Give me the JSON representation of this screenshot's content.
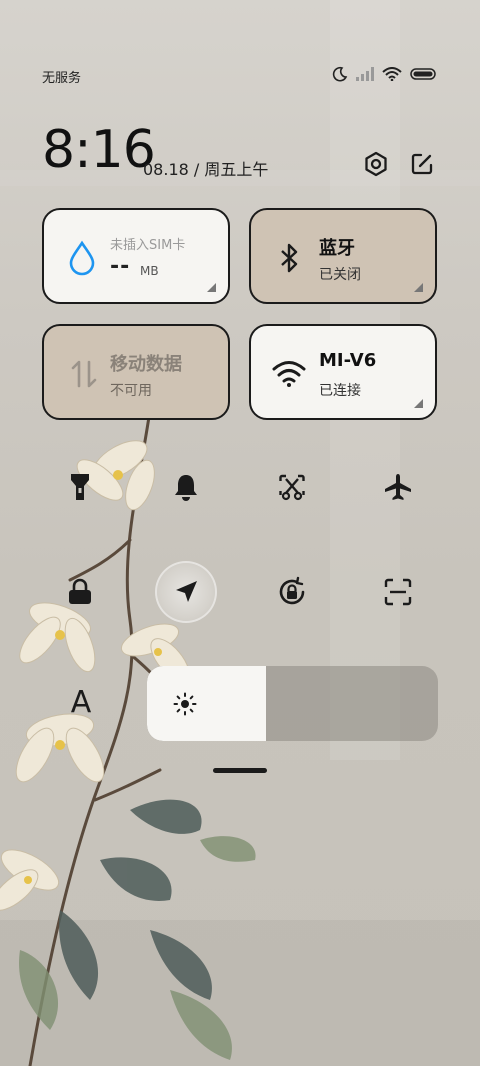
{
  "status_bar": {
    "carrier": "无服务",
    "icons": [
      "moon-icon",
      "signal-icon",
      "wifi-icon",
      "battery-icon"
    ]
  },
  "header": {
    "time": "8:16",
    "date": "08.18 / 周五上午",
    "buttons": [
      "settings-icon",
      "edit-icon"
    ]
  },
  "tiles": {
    "data_usage": {
      "label": "未插入SIM卡",
      "value": "--",
      "unit": "MB",
      "icon": "water-drop-icon",
      "accent": "#1e95f0"
    },
    "bluetooth": {
      "title": "蓝牙",
      "status": "已关闭",
      "icon": "bluetooth-icon"
    },
    "mobile_data": {
      "title": "移动数据",
      "status": "不可用",
      "icon": "mobile-data-icon"
    },
    "wifi": {
      "title": "MI-V6",
      "status": "已连接",
      "icon": "wifi-icon"
    }
  },
  "toggles": [
    {
      "icon": "flashlight-icon",
      "active": false
    },
    {
      "icon": "bell-icon",
      "active": false
    },
    {
      "icon": "screenshot-icon",
      "active": false
    },
    {
      "icon": "airplane-icon",
      "active": false
    },
    {
      "icon": "lock-icon",
      "active": false
    },
    {
      "icon": "location-icon",
      "active": true
    },
    {
      "icon": "rotation-lock-icon",
      "active": false
    },
    {
      "icon": "scan-icon",
      "active": false
    }
  ],
  "brightness": {
    "font_label": "A",
    "level": 0.41
  },
  "colors": {
    "tile_active": "#f6f5f2",
    "tile_inactive": "#cfc3b4",
    "outline": "#1b1b1b"
  }
}
